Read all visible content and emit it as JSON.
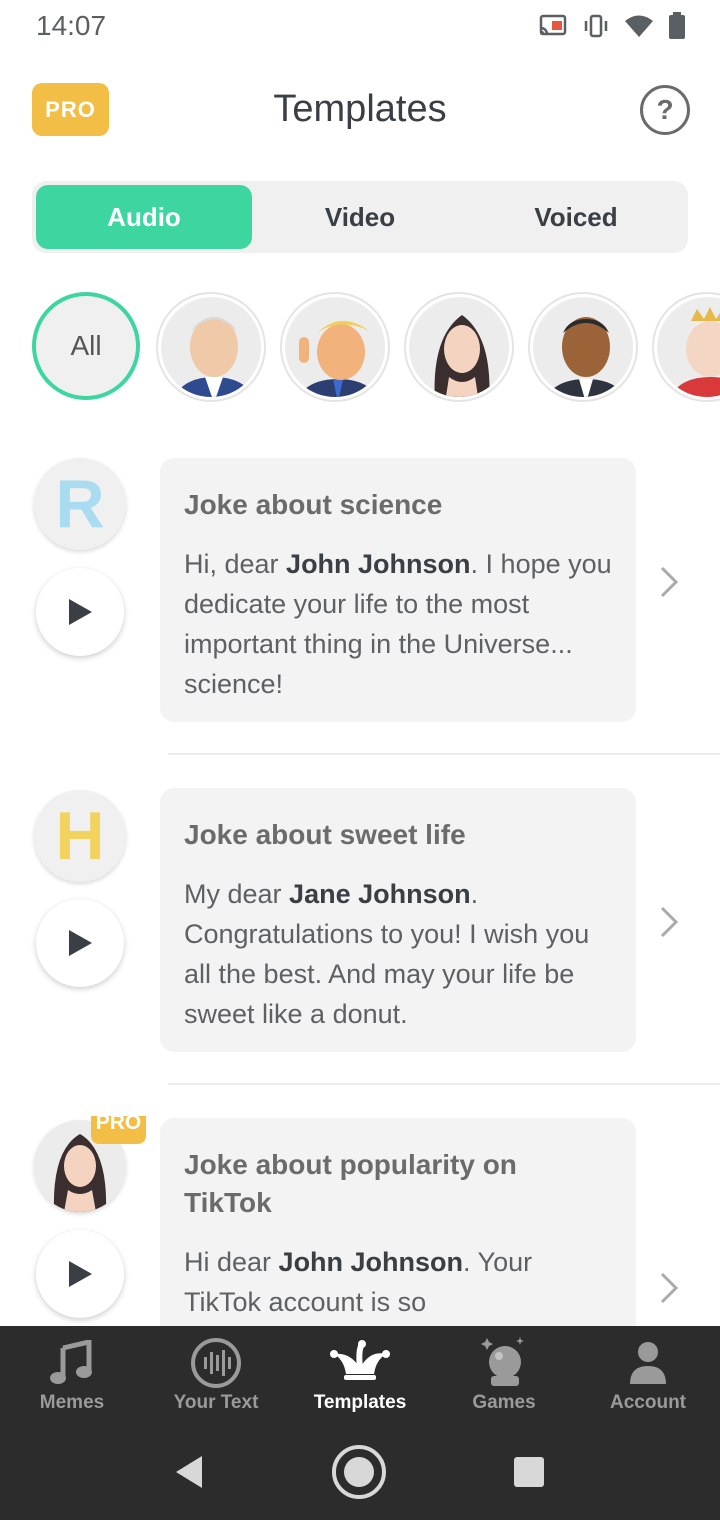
{
  "status_bar": {
    "time": "14:07"
  },
  "header": {
    "pro_label": "PRO",
    "title": "Templates",
    "help_label": "?"
  },
  "segments": [
    {
      "label": "Audio",
      "active": true
    },
    {
      "label": "Video",
      "active": false
    },
    {
      "label": "Voiced",
      "active": false
    }
  ],
  "filters": {
    "all_label": "All"
  },
  "templates": [
    {
      "letter": "R",
      "letter_color": "#a9dcf0",
      "title": "Joke about science",
      "body_pre": "Hi, dear ",
      "body_name": "John Johnson",
      "body_post": ". I hope you dedicate your life to the most important thing in the Universe... science!"
    },
    {
      "letter": "H",
      "letter_color": "#f1d35e",
      "title": "Joke about sweet life",
      "body_pre": "My dear ",
      "body_name": "Jane Johnson",
      "body_post": ". Congratulations to you! I wish you all the best. And may your life be sweet like a donut."
    },
    {
      "pro_label": "PRO",
      "title": "Joke about popularity on TikTok",
      "body_pre": "Hi dear ",
      "body_name": "John Johnson",
      "body_post": ". Your TikTok account is so"
    }
  ],
  "tabs": [
    {
      "label": "Memes",
      "icon": "music-note-icon"
    },
    {
      "label": "Your Text",
      "icon": "audio-wave-icon"
    },
    {
      "label": "Templates",
      "icon": "jester-hat-icon",
      "active": true
    },
    {
      "label": "Games",
      "icon": "crystal-ball-icon"
    },
    {
      "label": "Account",
      "icon": "person-icon"
    }
  ],
  "colors": {
    "accent": "#3dd6a0",
    "pro": "#f3be46",
    "tabbar": "#2c2c2c"
  }
}
